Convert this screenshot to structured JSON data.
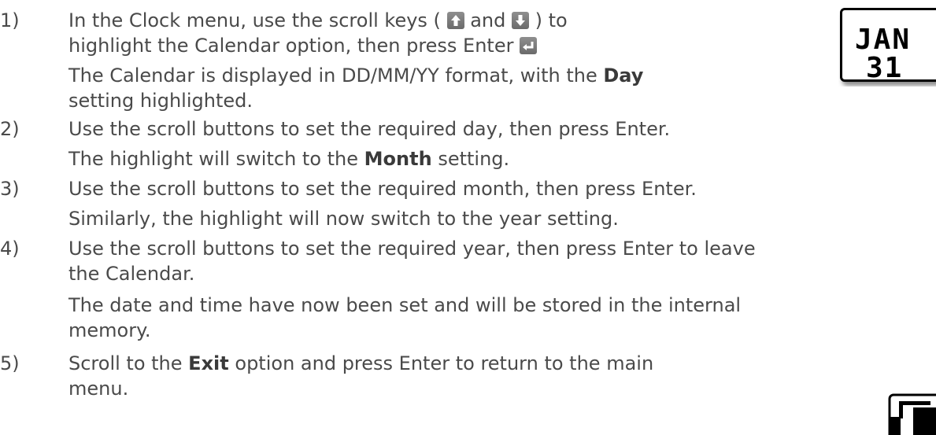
{
  "steps": [
    {
      "number": "1)",
      "line1_a": "In the Clock menu, use the scroll keys (",
      "line1_b": "and",
      "line1_c": ") to",
      "line2_a": "highlight the Calendar option, then press Enter",
      "line3": "The Calendar is displayed in DD/MM/YY format, with the",
      "line3_bold": "Day",
      "line4": "setting highlighted."
    },
    {
      "number": "2)",
      "line1": "Use the scroll buttons to set the required day, then press Enter.",
      "line2_a": "The highlight will switch to the",
      "line2_bold": "Month",
      "line2_b": "setting."
    },
    {
      "number": "3)",
      "line1": "Use the scroll buttons to set the required month, then press Enter.",
      "line2": "Similarly, the highlight will now switch to the year setting."
    },
    {
      "number": "4)",
      "line1": "Use the scroll buttons to set the required year, then press Enter to leave",
      "line2": "the Calendar.",
      "line3": "The date and time have now been set and will be stored in the internal",
      "line4": "memory."
    },
    {
      "number": "5)",
      "line1_a": "Scroll to the",
      "line1_bold": "Exit",
      "line1_b": "option and press Enter to return to the main",
      "line2": "menu."
    }
  ],
  "calendar_thumb": {
    "month": "JAN",
    "day": "31"
  },
  "icons": {
    "up_key": "scroll-up-key-icon",
    "down_key": "scroll-down-key-icon",
    "enter_key": "enter-key-icon"
  }
}
